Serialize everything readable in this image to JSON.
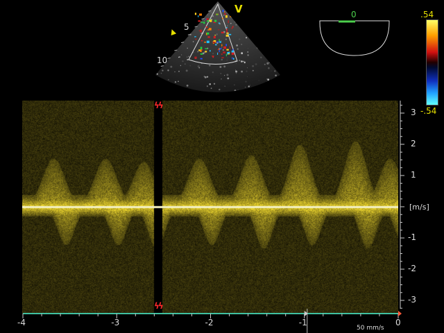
{
  "sector": {
    "mode_label": "V",
    "depth_marks": [
      "5",
      "10"
    ]
  },
  "angle": {
    "value": "0"
  },
  "color_scale": {
    "max": ".54",
    "min": "-.54"
  },
  "velocity_axis": {
    "unit": "[m/s]",
    "ticks": [
      {
        "label": "3",
        "v": 3
      },
      {
        "label": "2",
        "v": 2
      },
      {
        "label": "1",
        "v": 1
      },
      {
        "label": "-1",
        "v": -1
      },
      {
        "label": "-2",
        "v": -2
      },
      {
        "label": "-3",
        "v": -3
      }
    ]
  },
  "time_axis": {
    "sweep_speed": "50 mm/s",
    "ticks": [
      {
        "label": "-4",
        "t": -4
      },
      {
        "label": "-3",
        "t": -3
      },
      {
        "label": "-2",
        "t": -2
      },
      {
        "label": "-1",
        "t": -1
      },
      {
        "label": "0",
        "t": 0
      }
    ]
  },
  "colors": {
    "spectrum": "#e8d640",
    "baseline": "#f2efc0",
    "time_axis": "#3fc0a0",
    "sync_marker": "#ff2a2a",
    "angle_line": "#4ccf4c"
  }
}
